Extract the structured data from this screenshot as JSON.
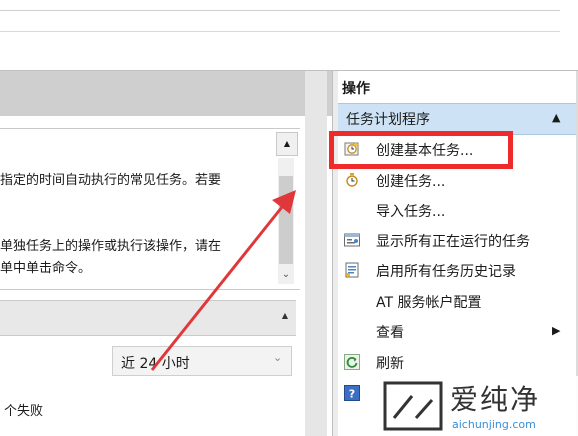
{
  "summary": {
    "lines": [
      "指定的时间自动执行的常见任务。若要",
      "",
      "",
      "单独任务上的操作或执行该操作，请在",
      "单中单击命令。"
    ]
  },
  "status": {
    "range_value": "近 24 小时",
    "failed_text": "个失败"
  },
  "actions": {
    "title": "操作",
    "group_label": "任务计划程序",
    "items": [
      {
        "label": "创建基本任务...",
        "icon": "create-basic-task-icon"
      },
      {
        "label": "创建任务...",
        "icon": "create-task-icon"
      },
      {
        "label": "导入任务...",
        "icon": ""
      },
      {
        "label": "显示所有正在运行的任务",
        "icon": "running-tasks-icon"
      },
      {
        "label": "启用所有任务历史记录",
        "icon": "history-icon"
      },
      {
        "label": "AT 服务帐户配置",
        "icon": ""
      },
      {
        "label": "查看",
        "icon": ""
      },
      {
        "label": "刷新",
        "icon": "refresh-icon"
      },
      {
        "label": "",
        "icon": "help-icon"
      }
    ]
  },
  "watermark": {
    "name": "爱纯净",
    "url": "aichunjing.com"
  },
  "colors": {
    "highlight": "#ee2a2a",
    "arrow": "#e0383a",
    "selected_group": "#cde3f5"
  }
}
